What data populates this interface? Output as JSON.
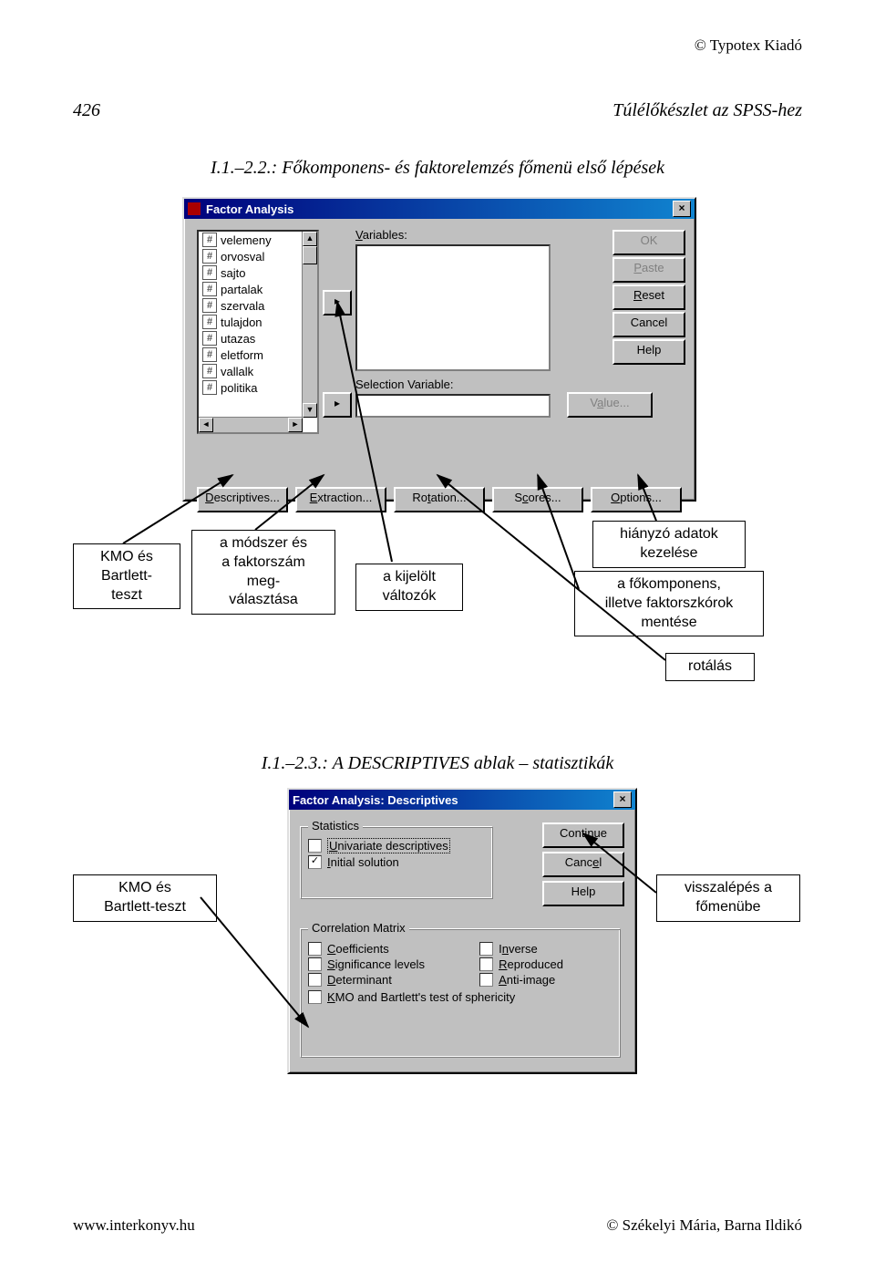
{
  "copyright_top": "© Typotex Kiadó",
  "page_number": "426",
  "running_head": "Túlélőkészlet az SPSS-hez",
  "fig1_title": "I.1.–2.2.: Főkomponens- és faktorelemzés főmenü első lépések",
  "fa_dialog": {
    "title": "Factor Analysis",
    "variables_lbl": "Variables:",
    "selvar_lbl": "Selection Variable:",
    "var_list": [
      "velemeny",
      "orvosval",
      "sajto",
      "partalak",
      "szervala",
      "tulajdon",
      "utazas",
      "eletform",
      "vallalk",
      "politika"
    ],
    "buttons": {
      "ok": "OK",
      "paste": "Paste",
      "reset": "Reset",
      "cancel": "Cancel",
      "help": "Help",
      "value": "Value..."
    },
    "bottom": [
      "Descriptives...",
      "Extraction...",
      "Rotation...",
      "Scores...",
      "Options..."
    ]
  },
  "callouts1": {
    "c1": "KMO és\nBartlett-\nteszt",
    "c2": "a módszer és\na faktorszám\nmeg-\nválasztása",
    "c3": "a kijelölt\nváltozók",
    "c4": "hiányzó adatok\nkezelése",
    "c5": "a főkomponens,\nilletve faktorszkórok\nmentése",
    "c6": "rotálás"
  },
  "fig2_title": "I.1.–2.3.: A DESCRIPTIVES ablak – statisztikák",
  "desc_dialog": {
    "title": "Factor Analysis: Descriptives",
    "stats_title": "Statistics",
    "univ": "Univariate descriptives",
    "init": "Initial solution",
    "init_checked": true,
    "corr_title": "Correlation Matrix",
    "coef": "Coefficients",
    "inv": "Inverse",
    "sig": "Significance levels",
    "rep": "Reproduced",
    "det": "Determinant",
    "ai": "Anti-image",
    "kmo": "KMO and Bartlett's test of sphericity",
    "continue": "Continue",
    "cancel": "Cancel",
    "help": "Help"
  },
  "callouts2": {
    "left": "KMO és\nBartlett-teszt",
    "right": "visszalépés a\nfőmenübe"
  },
  "footer_left": "www.interkonyv.hu",
  "footer_right": "© Székelyi Mária, Barna Ildikó"
}
